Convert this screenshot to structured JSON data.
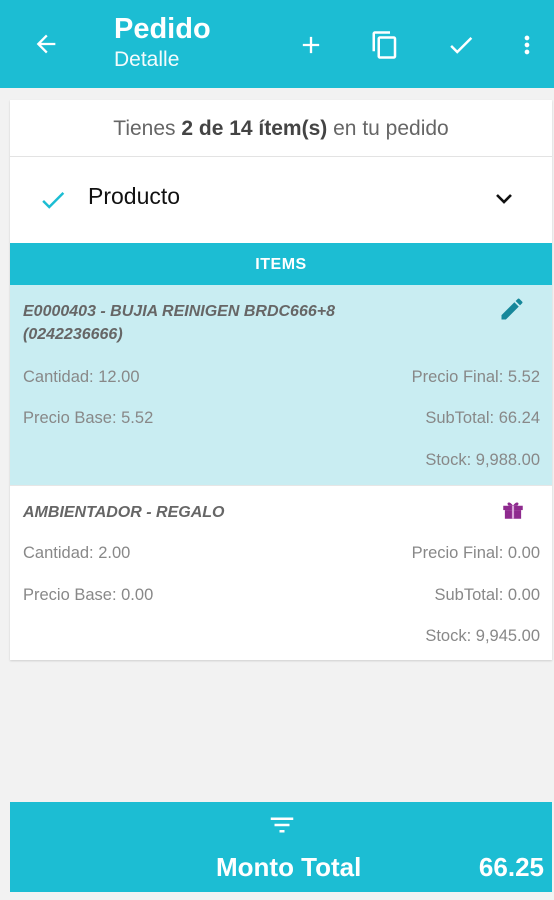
{
  "appbar": {
    "title": "Pedido",
    "subtitle": "Detalle",
    "icons": [
      "arrow-back-icon",
      "add-icon",
      "copy-icon",
      "check-icon",
      "more-vert-icon"
    ]
  },
  "summary": {
    "prefix": "Tienes",
    "count": "2 de 14 ítem(s)",
    "suffix": "en tu pedido"
  },
  "selector": {
    "label": "Producto"
  },
  "items_header": "ITEMS",
  "items": [
    {
      "name_line1": "E0000403 - BUJIA REINIGEN BRDC666+8",
      "name_line2": "(0242236666)",
      "cantidad": "Cantidad: 12.00",
      "precio_final": "Precio Final: 5.52",
      "precio_base": "Precio Base: 5.52",
      "subtotal": "SubTotal: 66.24",
      "stock": "Stock: 9,988.00",
      "icon": "edit-icon",
      "selected": true
    },
    {
      "name_line1": "AMBIENTADOR - REGALO",
      "cantidad": "Cantidad: 2.00",
      "precio_final": "Precio Final: 0.00",
      "precio_base": "Precio Base: 0.00",
      "subtotal": "SubTotal: 0.00",
      "stock": "Stock: 9,945.00",
      "icon": "gift-icon",
      "selected": false
    }
  ],
  "footer": {
    "total_label": "Monto Total",
    "total_value": "66.25"
  },
  "colors": {
    "primary": "#1cbdd3",
    "selected_row": "#c9edf2",
    "gift": "#8e2a8e",
    "edit": "#16879a"
  }
}
